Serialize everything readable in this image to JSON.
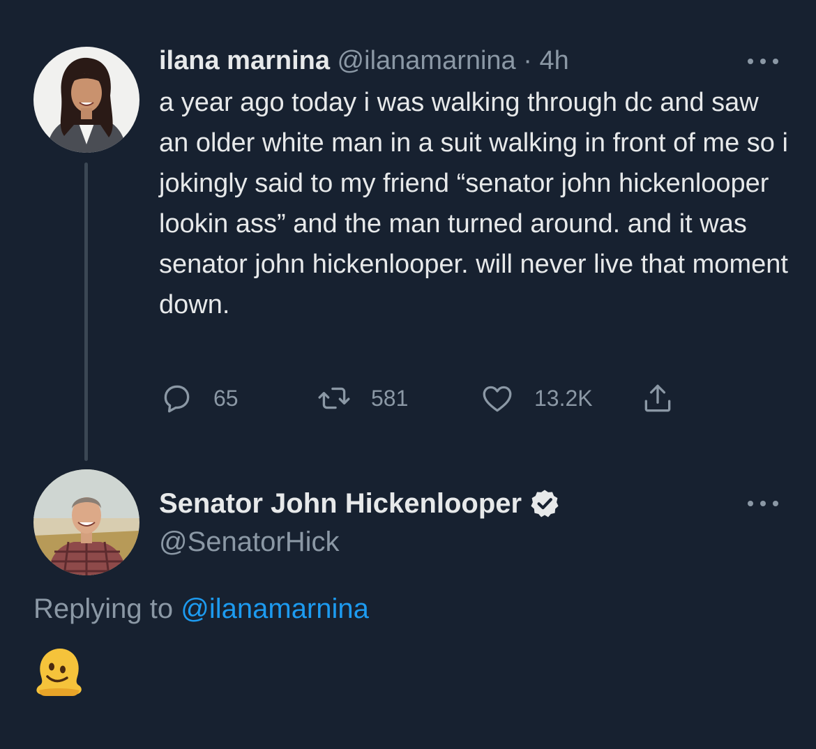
{
  "tweet": {
    "author_name": "ilana marnina",
    "author_handle": "@ilanamarnina",
    "separator": "·",
    "time": "4h",
    "text": "a year ago today i was walking through dc and saw an older white man in a suit walking in front of me so i jokingly said to my friend “senator john hickenlooper lookin ass” and the man turned around. and it was senator john hickenlooper. will never live that moment down.",
    "replies": "65",
    "retweets": "581",
    "likes": "13.2K"
  },
  "reply": {
    "author_name": "Senator John Hickenlooper",
    "author_handle": "@SenatorHick",
    "replying_prefix": "Replying to",
    "replying_handle": "@ilanamarnina",
    "body_emoji": "melting-face-emoji"
  },
  "colors": {
    "background": "#172130",
    "text": "#e7e9ea",
    "muted": "#8b98a5",
    "link": "#1d9bf0",
    "thread_line": "#3b4754"
  },
  "icons": [
    "more-icon",
    "reply-icon",
    "retweet-icon",
    "like-icon",
    "share-icon",
    "verified-badge-icon"
  ]
}
